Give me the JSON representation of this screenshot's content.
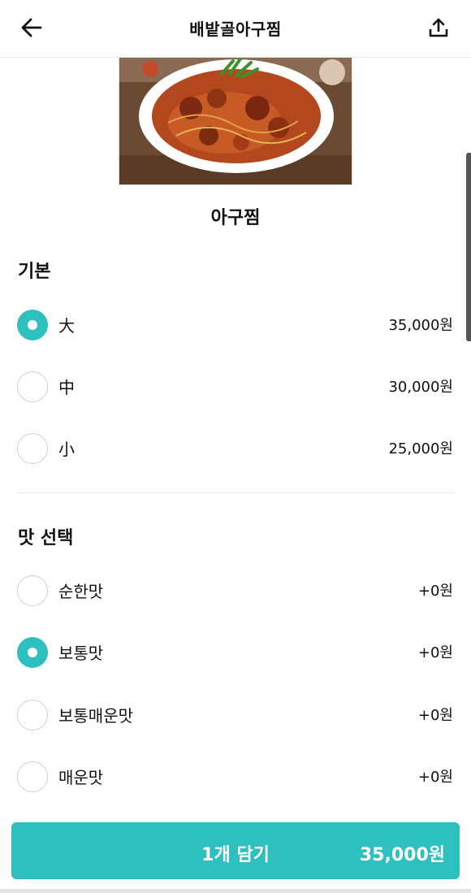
{
  "header": {
    "title": "배밭골아구찜",
    "back_icon": "arrow-left-icon",
    "share_icon": "share-upload-icon"
  },
  "menu": {
    "name": "아구찜"
  },
  "sections": [
    {
      "title": "기본",
      "options": [
        {
          "label": "大",
          "price": "35,000원",
          "selected": true
        },
        {
          "label": "中",
          "price": "30,000원",
          "selected": false
        },
        {
          "label": "小",
          "price": "25,000원",
          "selected": false
        }
      ]
    },
    {
      "title": "맛 선택",
      "options": [
        {
          "label": "순한맛",
          "price": "+0원",
          "selected": false
        },
        {
          "label": "보통맛",
          "price": "+0원",
          "selected": true
        },
        {
          "label": "보통매운맛",
          "price": "+0원",
          "selected": false
        },
        {
          "label": "매운맛",
          "price": "+0원",
          "selected": false
        }
      ]
    }
  ],
  "cart_button": {
    "label": "1개 담기",
    "price": "35,000원"
  },
  "colors": {
    "accent": "#2ec0be"
  }
}
